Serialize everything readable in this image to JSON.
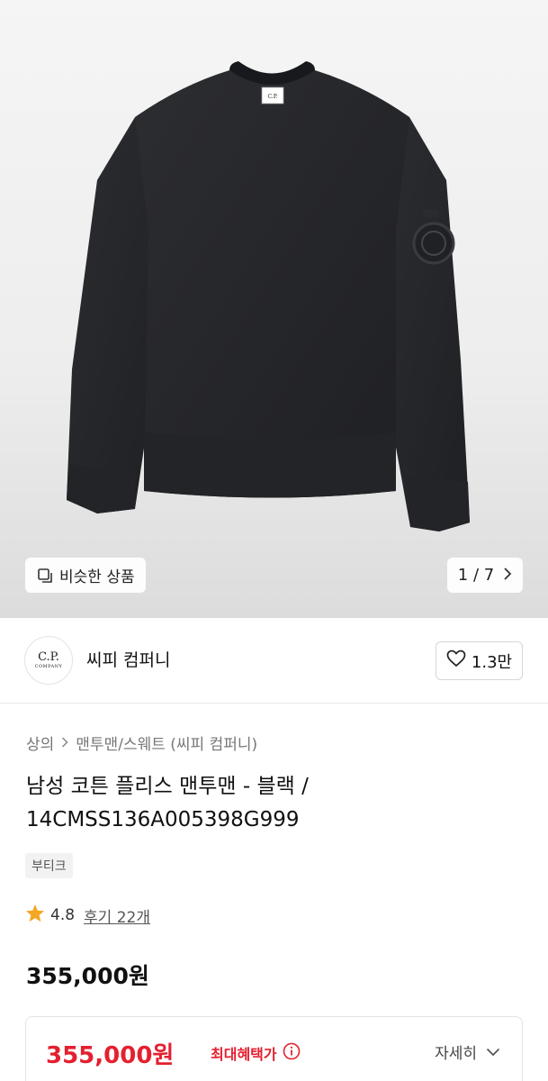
{
  "hero": {
    "similar_label": "비슷한 상품",
    "page_current": "1",
    "page_separator": "/",
    "page_total": "7",
    "collar_label": "C.P."
  },
  "brand": {
    "logo_text": "C.P.",
    "logo_subtext": "COMPANY",
    "name": "씨피 컴퍼니",
    "like_count": "1.3만"
  },
  "breadcrumb": {
    "category": "상의",
    "subcategory": "맨투맨/스웨트 (씨피 컴퍼니)"
  },
  "product": {
    "title": "남성 코튼 플리스 맨투맨 - 블랙 / 14CMSS136A005398G999",
    "tag": "부티크",
    "rating": "4.8",
    "review_label": "후기 22개",
    "price": "355,000원"
  },
  "benefit": {
    "price": "355,000원",
    "label": "최대혜택가",
    "detail_label": "자세히"
  },
  "colors": {
    "accent_red": "#e4202f",
    "star": "#f5a623"
  }
}
